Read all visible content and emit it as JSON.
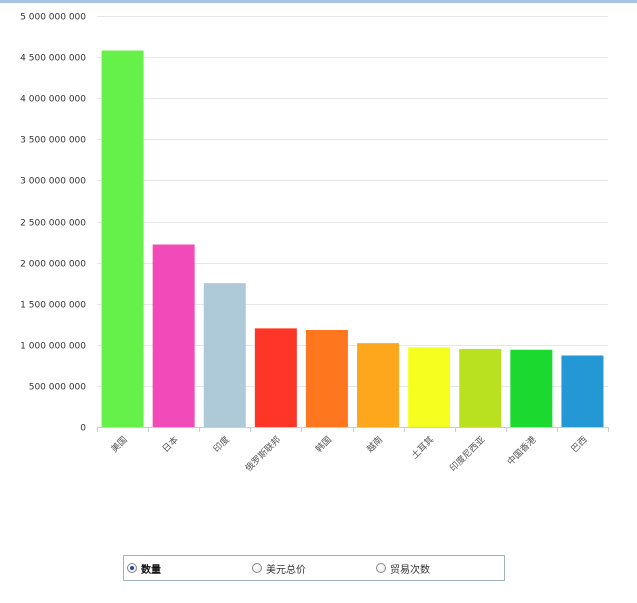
{
  "chart_data": {
    "type": "bar",
    "categories": [
      "美国",
      "日本",
      "印度",
      "俄罗斯联邦",
      "韩国",
      "越南",
      "土耳其",
      "印度尼西亚",
      "中国香港",
      "巴西"
    ],
    "values": [
      4580000000,
      2220000000,
      1750000000,
      1200000000,
      1180000000,
      1020000000,
      970000000,
      950000000,
      940000000,
      870000000
    ],
    "colors": [
      "#66f04a",
      "#f24bb9",
      "#aec9d8",
      "#fe3628",
      "#fe771f",
      "#fea61c",
      "#f5fe1e",
      "#b9e11f",
      "#1bd92f",
      "#2497d5"
    ],
    "ylim": [
      0,
      5000000000
    ],
    "yticks": [
      0,
      500000000,
      1000000000,
      1500000000,
      2000000000,
      2500000000,
      3000000000,
      3500000000,
      4000000000,
      4500000000,
      5000000000
    ],
    "ytick_labels": [
      "0",
      "500 000 000",
      "1 000 000 000",
      "1 500 000 000",
      "2 000 000 000",
      "2 500 000 000",
      "3 000 000 000",
      "3 500 000 000",
      "4 000 000 000",
      "4 500 000 000",
      "5 000 000 000"
    ],
    "grid": true,
    "title": "",
    "xlabel": "",
    "ylabel": ""
  },
  "legend": {
    "options": [
      {
        "label": "数量",
        "selected": true
      },
      {
        "label": "美元总价",
        "selected": false
      },
      {
        "label": "贸易次数",
        "selected": false
      }
    ]
  }
}
